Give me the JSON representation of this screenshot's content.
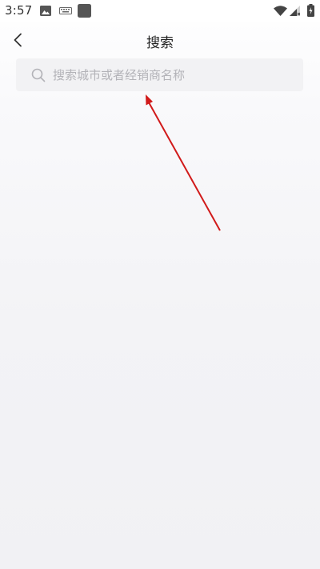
{
  "status_bar": {
    "time": "3:57",
    "left_icons": [
      "image-icon",
      "keyboard-icon",
      "app-square-icon"
    ],
    "right_icons": [
      "wifi-icon",
      "signal-icon",
      "battery-icon"
    ]
  },
  "nav": {
    "back_icon": "chevron-left-icon",
    "title": "搜索"
  },
  "search": {
    "icon": "search-icon",
    "placeholder": "搜索城市或者经销商名称",
    "value": ""
  },
  "annotation": {
    "arrow_color": "#d11a1a"
  }
}
